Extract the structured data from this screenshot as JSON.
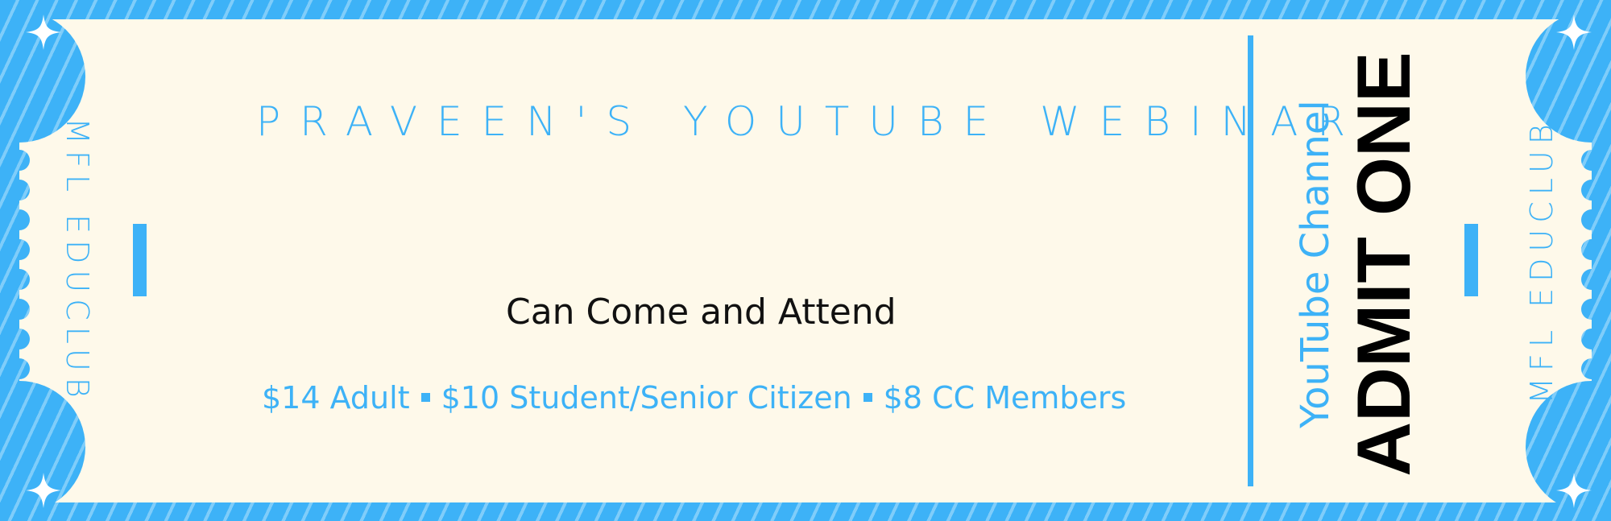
{
  "ticket": {
    "side_label_left": "MFL EDUCLUB",
    "side_label_right": "MFL EDUCLUB",
    "title": "PRAVEEN'S YOUTUBE WEBINAR",
    "subtitle": "Can Come and Attend",
    "prices": [
      "$14 Adult",
      "$10 Student/Senior Citizen",
      "$8 CC Members"
    ],
    "stub": {
      "channel": "YouTube Channel",
      "admit": "ADMIT ONE"
    }
  },
  "colors": {
    "accent": "#3db2f7",
    "paper": "#fef9ea",
    "text_dark": "#111111"
  },
  "icons": [
    "sparkle-icon"
  ]
}
